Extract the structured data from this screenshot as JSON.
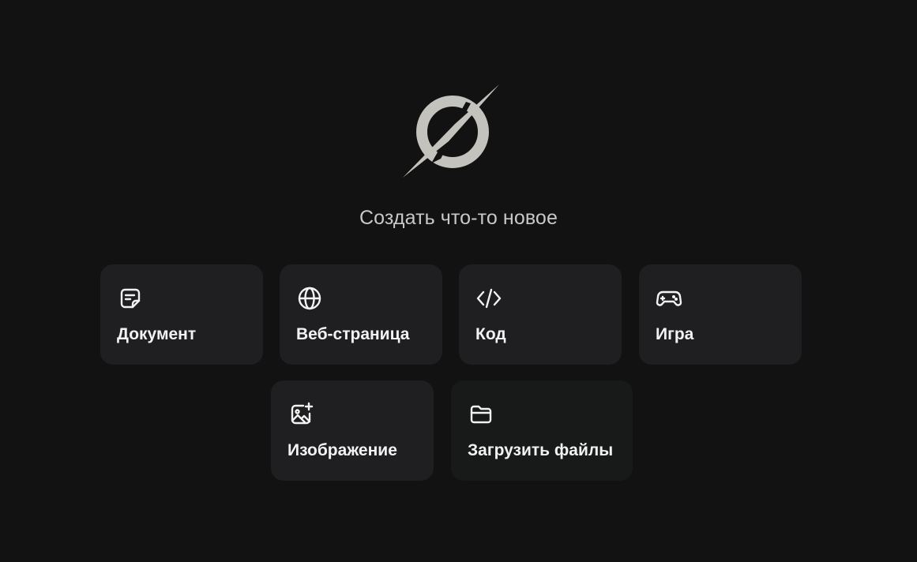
{
  "logo": {
    "icon": "compass-slash-logo"
  },
  "headline": "Создать что-то новое",
  "cards": [
    {
      "id": "document",
      "label": "Документ",
      "icon": "document-icon"
    },
    {
      "id": "webpage",
      "label": "Веб-страница",
      "icon": "globe-icon"
    },
    {
      "id": "code",
      "label": "Код",
      "icon": "code-icon"
    },
    {
      "id": "game",
      "label": "Игра",
      "icon": "gamepad-icon"
    },
    {
      "id": "image",
      "label": "Изображение",
      "icon": "image-sparkle-icon"
    },
    {
      "id": "upload",
      "label": "Загрузить файлы",
      "icon": "folder-icon"
    }
  ],
  "colors": {
    "background": "#121212",
    "card": "#1f1f21",
    "card_upload": "#181a19",
    "text": "#f2f2f2",
    "headline": "#c8c8c8",
    "logo": "#c4c2bd"
  }
}
